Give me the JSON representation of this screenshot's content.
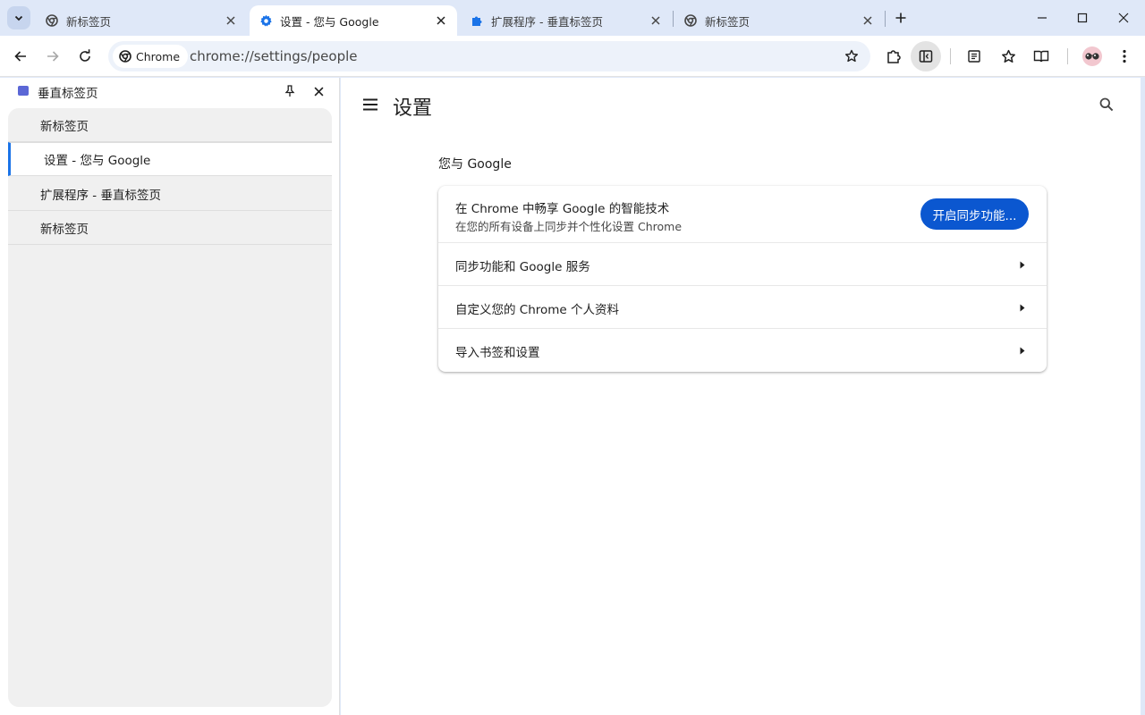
{
  "tabs": [
    {
      "title": "新标签页",
      "favicon": "chrome-icon",
      "active": false
    },
    {
      "title": "设置 - 您与 Google",
      "favicon": "gear-icon",
      "active": true
    },
    {
      "title": "扩展程序 - 垂直标签页",
      "favicon": "puzzle-icon",
      "active": false
    },
    {
      "title": "新标签页",
      "favicon": "chrome-icon",
      "active": false
    }
  ],
  "omnibox": {
    "chip_label": "Chrome",
    "url": "chrome://settings/people"
  },
  "side_panel": {
    "title": "垂直标签页",
    "items": [
      {
        "label": "新标签页",
        "active": false
      },
      {
        "label": "设置 - 您与 Google",
        "active": true
      },
      {
        "label": "扩展程序 - 垂直标签页",
        "active": false
      },
      {
        "label": "新标签页",
        "active": false
      }
    ]
  },
  "settings": {
    "page_title": "设置",
    "section_title": "您与 Google",
    "promo_title": "在 Chrome 中畅享 Google 的智能技术",
    "promo_subtitle": "在您的所有设备上同步并个性化设置 Chrome",
    "sync_button": "开启同步功能...",
    "rows": [
      {
        "label": "同步功能和 Google 服务"
      },
      {
        "label": "自定义您的 Chrome 个人资料"
      },
      {
        "label": "导入书签和设置"
      }
    ]
  },
  "colors": {
    "frame": "#dfe8f8",
    "accent": "#0b57d0",
    "active_indicator": "#1a73e8"
  }
}
